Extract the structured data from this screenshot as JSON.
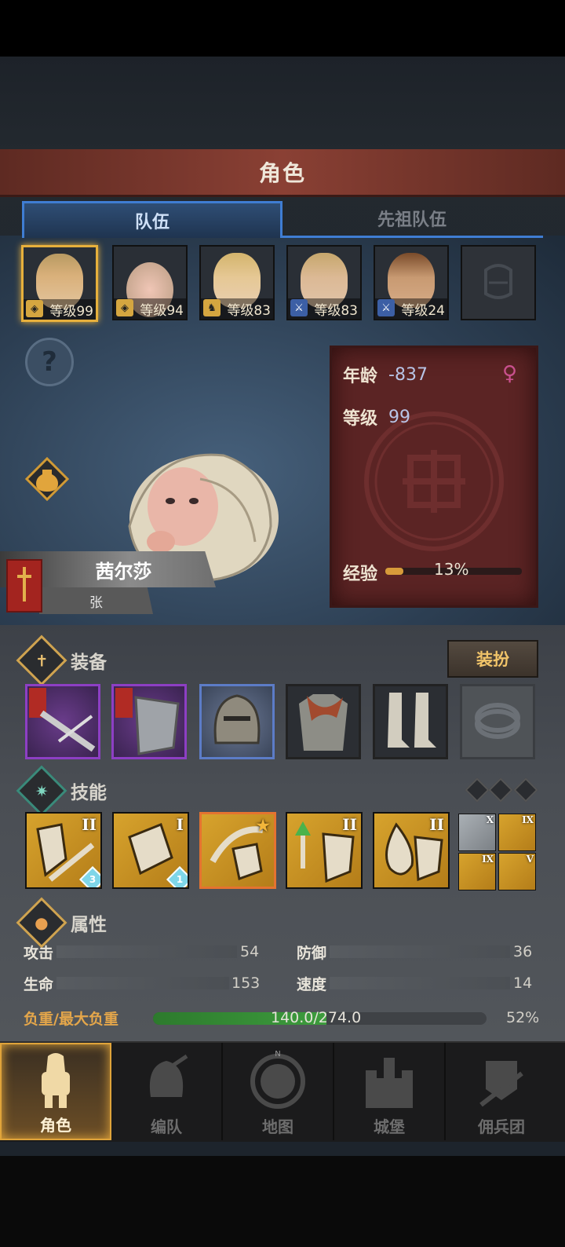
{
  "header": {
    "title": "角色"
  },
  "tabs": [
    {
      "label": "队伍",
      "active": true
    },
    {
      "label": "先祖队伍",
      "active": false
    }
  ],
  "party": [
    {
      "level_text": "等级99",
      "selected": true
    },
    {
      "level_text": "等级94",
      "selected": false
    },
    {
      "level_text": "等级83",
      "selected": false
    },
    {
      "level_text": "等级83",
      "selected": false
    },
    {
      "level_text": "等级24",
      "selected": false
    },
    {
      "level_text": "",
      "selected": false
    }
  ],
  "character": {
    "name": "茜尔莎",
    "family": "张",
    "age_label": "年龄",
    "age_value": "-837",
    "level_label": "等级",
    "level_value": "99",
    "xp_label": "经验",
    "xp_percent_text": "13%",
    "xp_fraction": 0.13
  },
  "equipment": {
    "title": "装备",
    "dress_button": "装扮"
  },
  "skills": {
    "title": "技能",
    "items": [
      {
        "rank": "II",
        "level": "3"
      },
      {
        "rank": "I",
        "level": "1"
      },
      {
        "rank": "",
        "level": ""
      },
      {
        "rank": "II",
        "level": ""
      },
      {
        "rank": "II",
        "level": ""
      }
    ],
    "mini": [
      {
        "rank": "X"
      },
      {
        "rank": "IX"
      },
      {
        "rank": "IX"
      },
      {
        "rank": "V"
      }
    ]
  },
  "attributes": {
    "title": "属性",
    "attack_label": "攻击",
    "attack_value": "54",
    "defense_label": "防御",
    "defense_value": "36",
    "hp_label": "生命",
    "hp_value": "153",
    "speed_label": "速度",
    "speed_value": "14",
    "carry_label": "负重/最大负重",
    "carry_text": "140.0/274.0",
    "carry_percent_text": "52%",
    "carry_fraction": 0.52
  },
  "nav": [
    {
      "label": "角色",
      "active": true
    },
    {
      "label": "编队",
      "active": false
    },
    {
      "label": "地图",
      "active": false
    },
    {
      "label": "城堡",
      "active": false
    },
    {
      "label": "佣兵团",
      "active": false
    }
  ],
  "compass_n": "N",
  "colors": {
    "accent": "#e7b03c",
    "tab_blue": "#3f7dd3",
    "info_panel": "#5b2424",
    "gender": "#c9508e"
  }
}
